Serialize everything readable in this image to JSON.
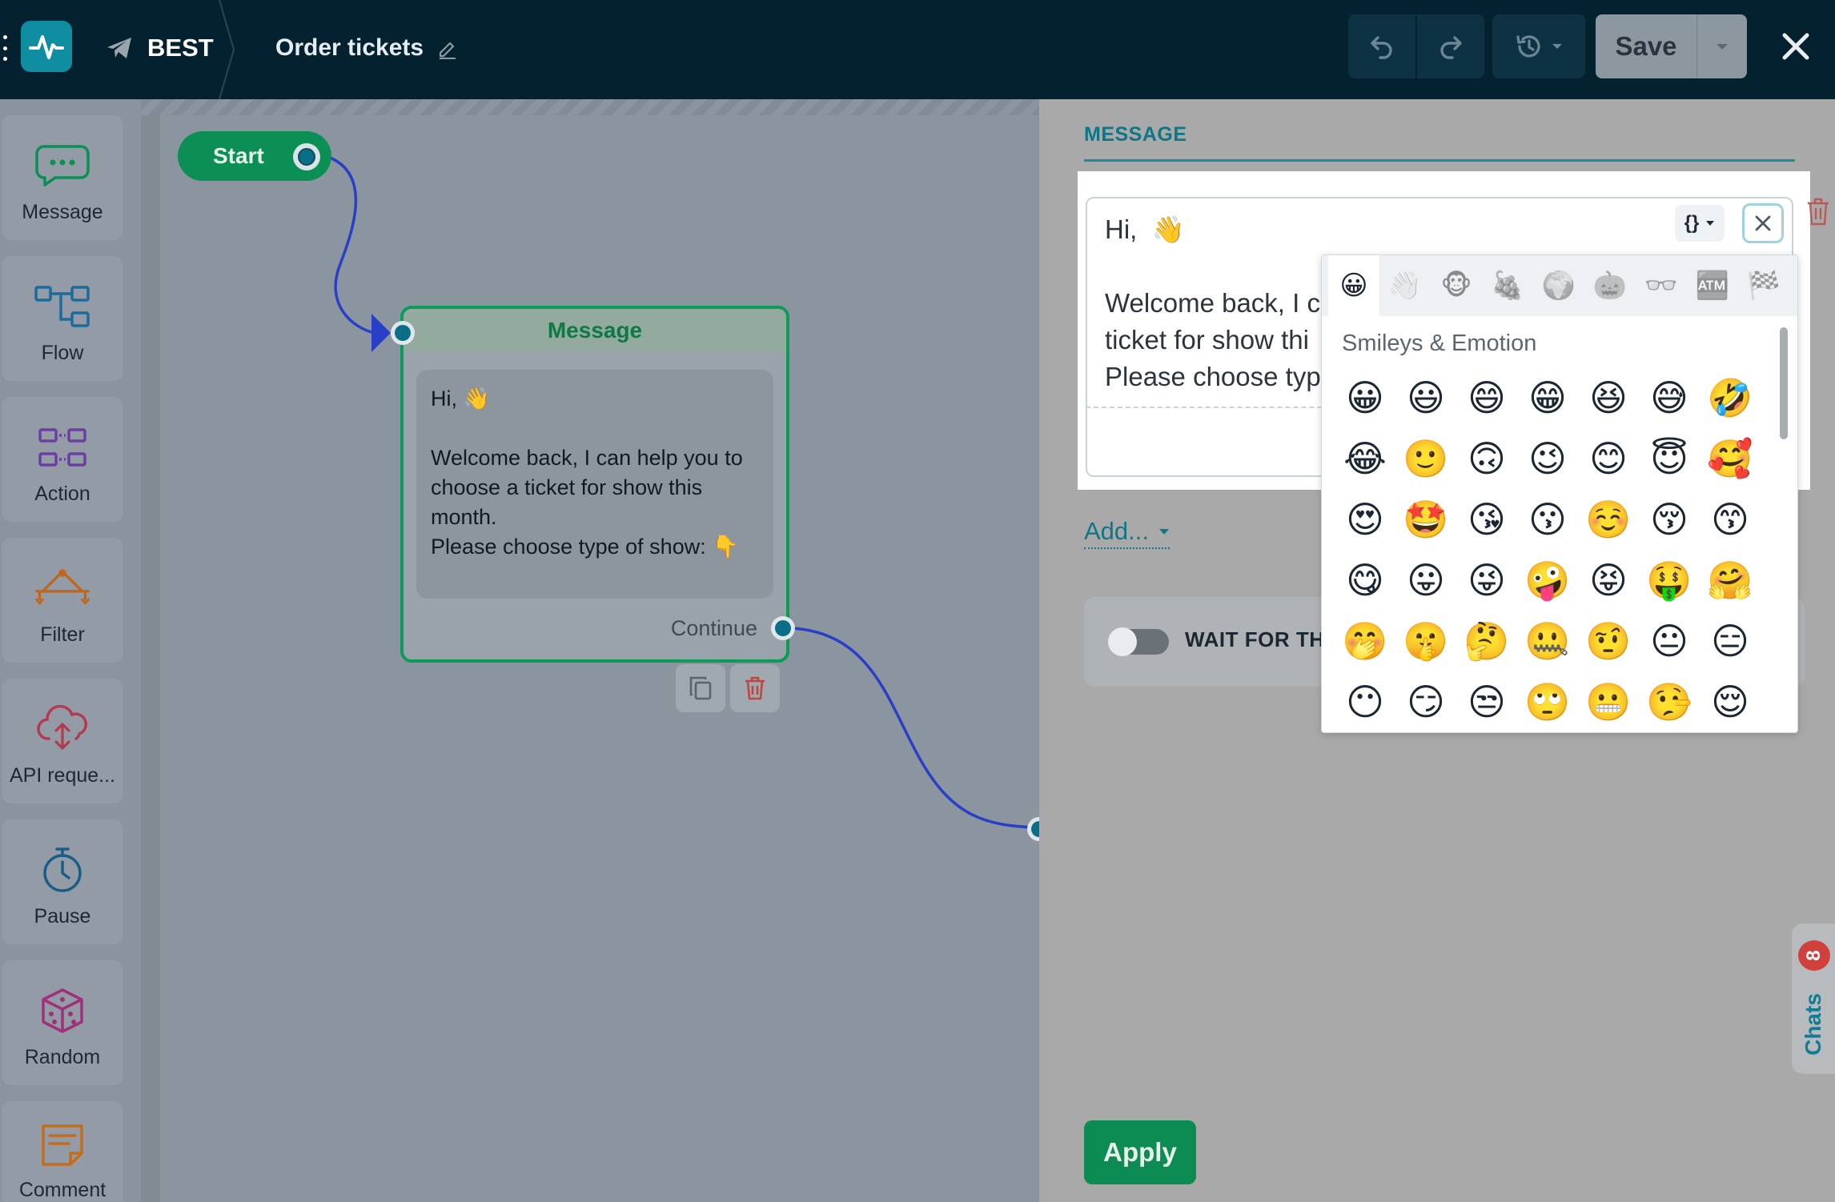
{
  "header": {
    "bot_name": "BEST",
    "flow_title": "Order tickets",
    "save_label": "Save"
  },
  "palette": [
    {
      "label": "Message",
      "icon": "message-icon",
      "color": "#0c8f55"
    },
    {
      "label": "Flow",
      "icon": "flow-icon",
      "color": "#1d6b9c"
    },
    {
      "label": "Action",
      "icon": "action-icon",
      "color": "#6b3fa0"
    },
    {
      "label": "Filter",
      "icon": "filter-icon",
      "color": "#c0661a"
    },
    {
      "label": "API reque...",
      "icon": "api-cloud-icon",
      "color": "#b43a4f"
    },
    {
      "label": "Pause",
      "icon": "stopwatch-icon",
      "color": "#1c5d86"
    },
    {
      "label": "Random",
      "icon": "dice-icon",
      "color": "#a0307a"
    },
    {
      "label": "Comment",
      "icon": "note-icon",
      "color": "#c26d1c"
    }
  ],
  "canvas": {
    "start_label": "Start",
    "node": {
      "title": "Message",
      "text": "Hi, 👋\n\nWelcome back, I can help you to choose a ticket for show this month.\nPlease choose type of show: 👇",
      "continue_label": "Continue"
    }
  },
  "panel": {
    "tab_label": "MESSAGE",
    "editor_text": "Hi,  👋\n\nWelcome back, I c\nticket for show thi\nPlease choose typ",
    "var_label": "{}",
    "add_label": "Add...",
    "wait_label": "WAIT FOR TH",
    "apply_label": "Apply",
    "chats_label": "Chats",
    "chats_count": "8"
  },
  "emoji_picker": {
    "heading": "Smileys & Emotion",
    "categories": [
      "😀",
      "👋🏻",
      "🐵",
      "🍇",
      "🌍",
      "🎃",
      "👓",
      "🏧",
      "🏁"
    ],
    "emojis": [
      "😀",
      "😃",
      "😄",
      "😁",
      "😆",
      "😅",
      "🤣",
      "😂",
      "🙂",
      "🙃",
      "😉",
      "😊",
      "😇",
      "🥰",
      "😍",
      "🤩",
      "😘",
      "😗",
      "☺️",
      "😚",
      "😙",
      "😋",
      "😛",
      "😜",
      "🤪",
      "😝",
      "🤑",
      "🤗",
      "🤭",
      "🤫",
      "🤔",
      "🤐",
      "🤨",
      "😐",
      "😑",
      "😶",
      "😏",
      "😒",
      "🙄",
      "😬",
      "🤥",
      "😌"
    ]
  },
  "colors": {
    "topbar": "#03212f",
    "accent_teal": "#0e7787",
    "green": "#0c8f55",
    "wire": "#2a3fc8"
  }
}
